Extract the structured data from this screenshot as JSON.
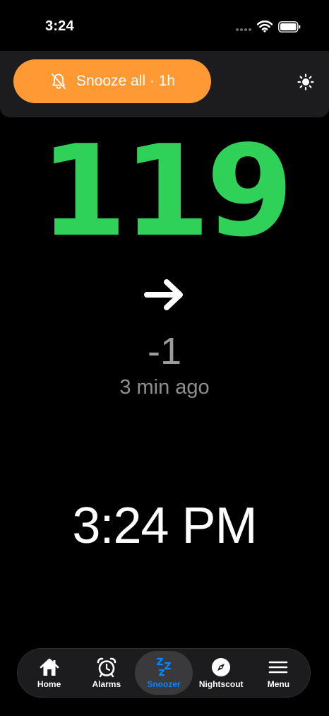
{
  "status_bar": {
    "time": "3:24",
    "icons": [
      "signal-dots",
      "wifi-icon",
      "battery-icon"
    ]
  },
  "header": {
    "snooze_all_label": "Snooze all · 1h",
    "bell_icon": "bell-slash-icon",
    "theme_icon": "sun-icon"
  },
  "reading": {
    "glucose": "119",
    "trend_icon": "arrow-right-icon",
    "delta": "-1",
    "age": "3 min ago",
    "color": "#30d158"
  },
  "clock": {
    "time": "3:24 PM"
  },
  "tabs": [
    {
      "label": "Home",
      "icon": "house-icon",
      "active": false
    },
    {
      "label": "Alarms",
      "icon": "alarm-clock-icon",
      "active": false
    },
    {
      "label": "Snoozer",
      "icon": "zzz-icon",
      "active": true
    },
    {
      "label": "Nightscout",
      "icon": "compass-icon",
      "active": false
    },
    {
      "label": "Menu",
      "icon": "hamburger-menu-icon",
      "active": false
    }
  ],
  "colors": {
    "accent_orange": "#ff9933",
    "active_tab": "#0a84ff"
  }
}
